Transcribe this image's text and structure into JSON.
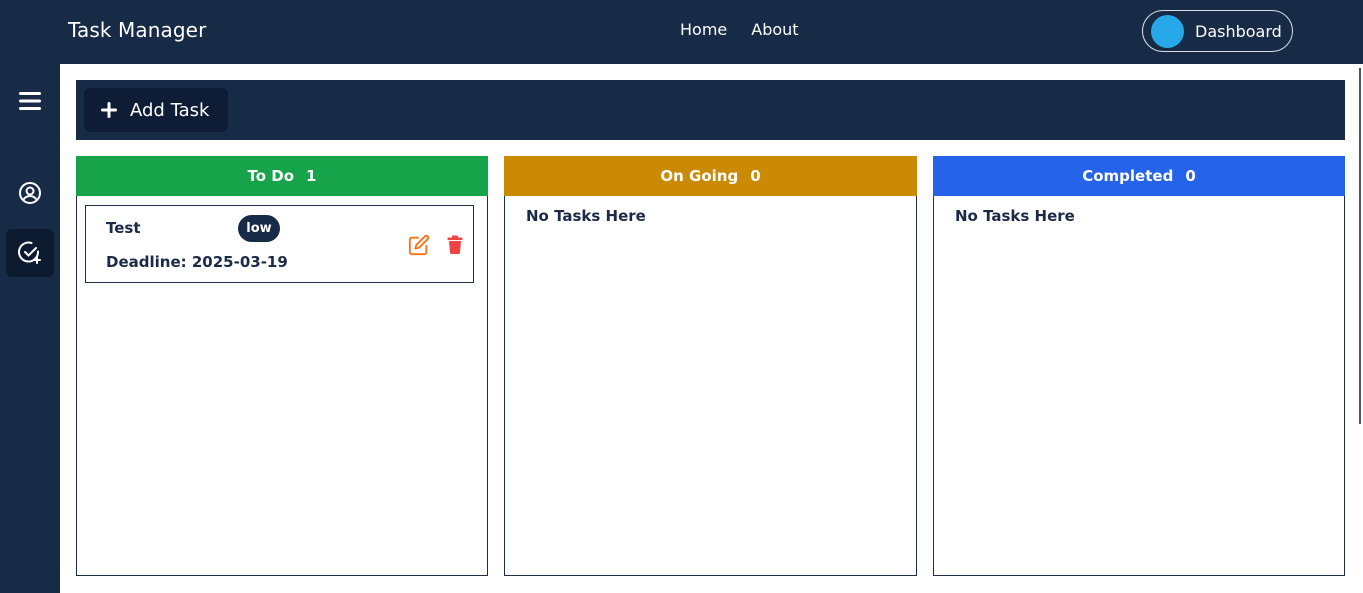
{
  "app": {
    "title": "Task Manager"
  },
  "nav": {
    "home": "Home",
    "about": "About",
    "dashboard": "Dashboard"
  },
  "toolbar": {
    "add_task": "Add Task"
  },
  "columns": [
    {
      "title": "To Do",
      "count": "1",
      "color": "#16a34a"
    },
    {
      "title": "On Going",
      "count": "0",
      "color": "#ca8a04",
      "empty": "No Tasks Here"
    },
    {
      "title": "Completed",
      "count": "0",
      "color": "#2563eb",
      "empty": "No Tasks Here"
    }
  ],
  "tasks": [
    {
      "title": "Test",
      "priority": "low",
      "deadline": "Deadline: 2025-03-19"
    }
  ],
  "icons": {
    "sidebar": [
      "menu-icon",
      "user-circle-icon",
      "check-add-icon"
    ],
    "task_actions": [
      "edit-icon",
      "trash-icon"
    ]
  },
  "colors": {
    "navy": "#172a46",
    "edit": "#f97316",
    "delete": "#ef4444"
  }
}
